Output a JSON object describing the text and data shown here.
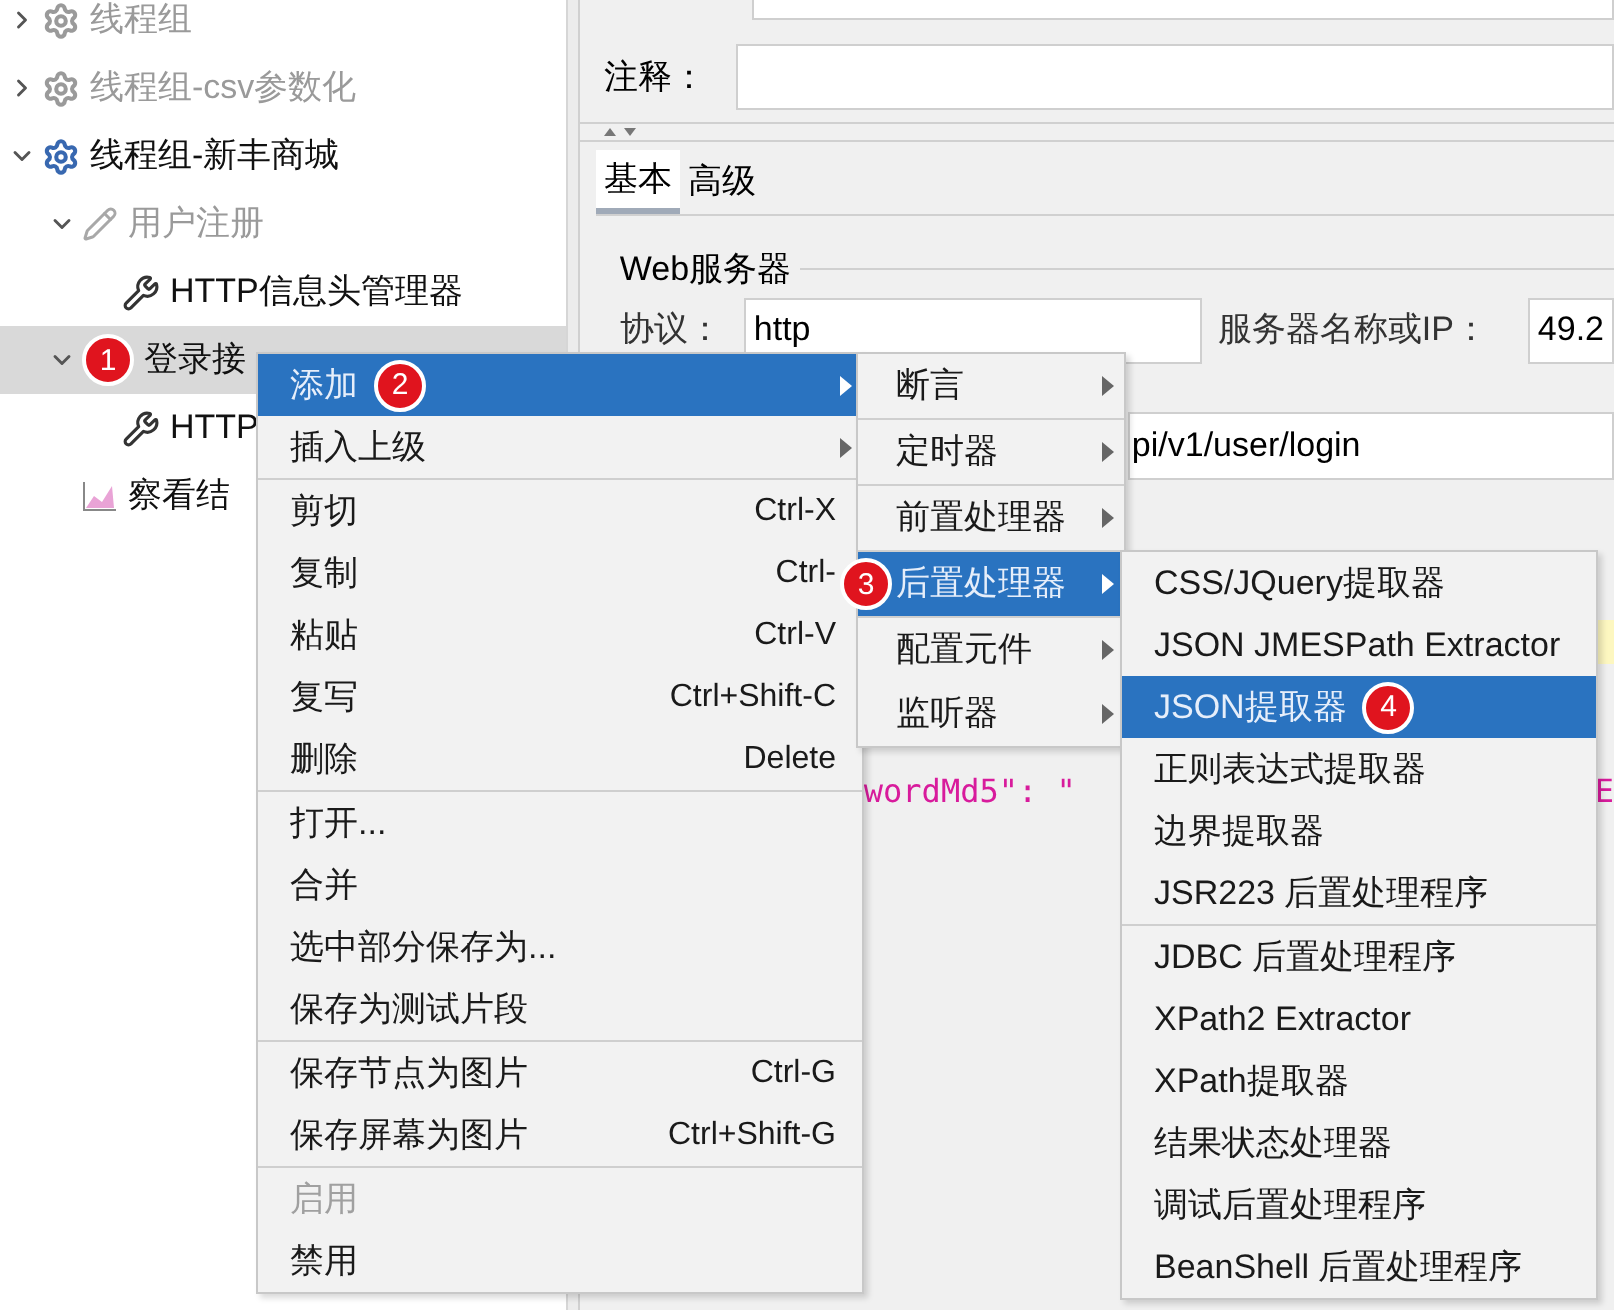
{
  "tree": [
    {
      "label": "线程组",
      "kind": "thread-group",
      "expanded": false,
      "disabled": true,
      "selected": false
    },
    {
      "label": "线程组-csv参数化",
      "kind": "thread-group",
      "expanded": false,
      "disabled": true,
      "selected": false
    },
    {
      "label": "线程组-新丰商城",
      "kind": "thread-group",
      "expanded": true,
      "disabled": false,
      "selected": false,
      "children": [
        {
          "label": "用户注册",
          "kind": "sampler",
          "expanded": true,
          "disabled": true,
          "selected": false,
          "children": [
            {
              "label": "HTTP信息头管理器",
              "kind": "config",
              "disabled": false,
              "selected": false
            }
          ]
        },
        {
          "label": "登录接",
          "kind": "badge",
          "badge": "1",
          "expanded": true,
          "disabled": false,
          "selected": true,
          "children": [
            {
              "label": "HTTP",
              "kind": "config",
              "disabled": false,
              "selected": false
            }
          ]
        },
        {
          "label": "察看结",
          "kind": "listener",
          "disabled": false,
          "selected": false
        }
      ]
    }
  ],
  "form": {
    "comment_label": "注释：",
    "tabs": [
      {
        "label": "基本",
        "selected": true
      },
      {
        "label": "高级",
        "selected": false
      }
    ],
    "group_title": "Web服务器",
    "protocol_label": "协议：",
    "protocol_value": "http",
    "server_label": "服务器名称或IP：",
    "server_value": "49.2",
    "path_value": "pi/v1/user/login",
    "body_text": "wordMd5\": \"",
    "body_text_right": "E"
  },
  "context_menu": {
    "groups": [
      [
        {
          "label": "添加",
          "submenu": true,
          "selected": true,
          "badge": "2"
        },
        {
          "label": "插入上级",
          "submenu": true,
          "selected": false
        }
      ],
      [
        {
          "label": "剪切",
          "shortcut": "Ctrl-X",
          "selected": false
        },
        {
          "label": "复制",
          "shortcut": "Ctrl-",
          "selected": false
        },
        {
          "label": "粘贴",
          "shortcut": "Ctrl-V",
          "selected": false
        },
        {
          "label": "复写",
          "shortcut": "Ctrl+Shift-C",
          "selected": false
        },
        {
          "label": "删除",
          "shortcut": "Delete",
          "selected": false
        }
      ],
      [
        {
          "label": "打开...",
          "selected": false
        },
        {
          "label": "合并",
          "selected": false
        },
        {
          "label": "选中部分保存为...",
          "selected": false
        },
        {
          "label": "保存为测试片段",
          "selected": false
        }
      ],
      [
        {
          "label": "保存节点为图片",
          "shortcut": "Ctrl-G",
          "selected": false
        },
        {
          "label": "保存屏幕为图片",
          "shortcut": "Ctrl+Shift-G",
          "selected": false
        }
      ],
      [
        {
          "label": "启用",
          "disabled": true,
          "selected": false
        },
        {
          "label": "禁用",
          "selected": false
        }
      ]
    ]
  },
  "add_submenu": {
    "groups": [
      [
        {
          "label": "断言",
          "submenu": true,
          "selected": false
        }
      ],
      [
        {
          "label": "定时器",
          "submenu": true,
          "selected": false
        }
      ],
      [
        {
          "label": "前置处理器",
          "submenu": true,
          "selected": false
        }
      ],
      [
        {
          "label": "后置处理器",
          "submenu": true,
          "selected": true,
          "badge": "3"
        }
      ],
      [
        {
          "label": "配置元件",
          "submenu": true,
          "selected": false
        },
        {
          "label": "监听器",
          "submenu": true,
          "selected": false
        }
      ]
    ]
  },
  "post_processor_submenu": {
    "groups": [
      [
        {
          "label": "CSS/JQuery提取器",
          "selected": false
        },
        {
          "label": "JSON JMESPath Extractor",
          "selected": false
        },
        {
          "label": "JSON提取器",
          "selected": true,
          "badge": "4"
        },
        {
          "label": "正则表达式提取器",
          "selected": false
        },
        {
          "label": "边界提取器",
          "selected": false
        },
        {
          "label": "JSR223 后置处理程序",
          "selected": false
        }
      ],
      [
        {
          "label": "JDBC 后置处理程序",
          "selected": false
        },
        {
          "label": "XPath2 Extractor",
          "selected": false
        },
        {
          "label": "XPath提取器",
          "selected": false
        },
        {
          "label": "结果状态处理器",
          "selected": false
        },
        {
          "label": "调试后置处理程序",
          "selected": false
        },
        {
          "label": "BeanShell 后置处理程序",
          "selected": false
        }
      ]
    ]
  }
}
